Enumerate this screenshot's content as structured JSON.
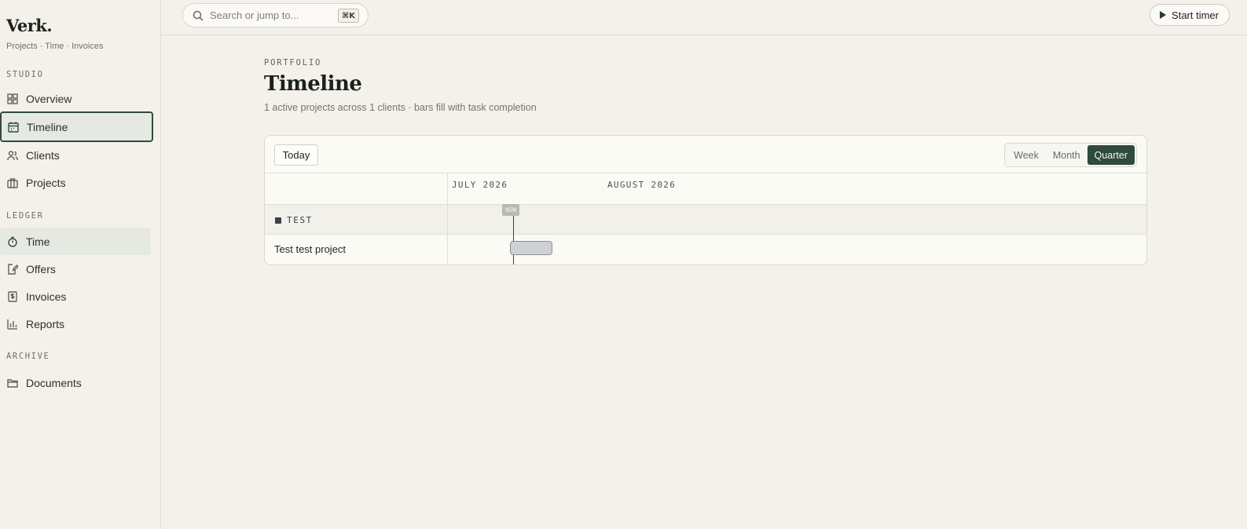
{
  "brand": {
    "name": "Verk.",
    "tagline": "Projects · Time · Invoices"
  },
  "sidebar": {
    "sections": [
      {
        "label": "STUDIO",
        "items": [
          {
            "label": "Overview",
            "icon": "grid-icon"
          },
          {
            "label": "Timeline",
            "icon": "calendar-icon",
            "state": "active"
          },
          {
            "label": "Clients",
            "icon": "users-icon"
          },
          {
            "label": "Projects",
            "icon": "briefcase-icon"
          }
        ]
      },
      {
        "label": "LEDGER",
        "items": [
          {
            "label": "Time",
            "icon": "stopwatch-icon",
            "state": "highlight"
          },
          {
            "label": "Offers",
            "icon": "document-edit-icon"
          },
          {
            "label": "Invoices",
            "icon": "invoice-dollar-icon"
          },
          {
            "label": "Reports",
            "icon": "bar-chart-icon"
          }
        ]
      },
      {
        "label": "ARCHIVE",
        "items": [
          {
            "label": "Documents",
            "icon": "folder-icon"
          }
        ]
      }
    ]
  },
  "topbar": {
    "search_placeholder": "Search or jump to...",
    "shortcut": "⌘K",
    "start_timer_label": "Start timer"
  },
  "main": {
    "eyebrow": "PORTFOLIO",
    "title": "Timeline",
    "subtitle": "1 active projects across 1 clients · bars fill with task completion"
  },
  "timeline": {
    "today_label": "Today",
    "views": [
      "Week",
      "Month",
      "Quarter"
    ],
    "selected_view": "Quarter",
    "months": [
      "JULY 2026",
      "AUGUST 2026"
    ],
    "now_label": "NOW",
    "groups": [
      {
        "name": "TEST",
        "color": "#3b4048",
        "projects": [
          {
            "name": "Test test project",
            "completion": 0
          }
        ]
      }
    ]
  },
  "colors": {
    "accent": "#2f4a3e",
    "background": "#f4f1eb",
    "bar": "#cfd1d4"
  }
}
